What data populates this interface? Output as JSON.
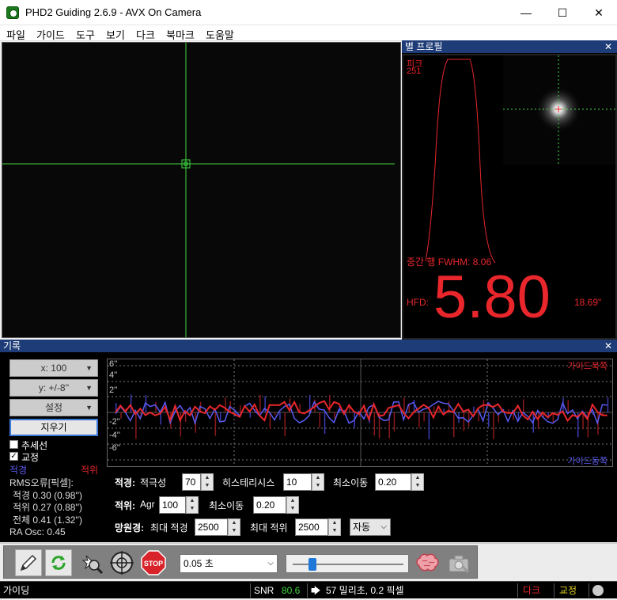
{
  "window": {
    "title": "PHD2 Guiding 2.6.9 - AVX On Camera",
    "minimize": "—",
    "maximize": "☐",
    "close": "✕"
  },
  "menu": {
    "file": "파일",
    "guide": "가이드",
    "tools": "도구",
    "view": "보기",
    "dark": "다크",
    "bookmarks": "북마크",
    "help": "도움말"
  },
  "star_profile": {
    "header": "별 프로필",
    "close": "✕",
    "peak_label": "피크",
    "peak_value": "251",
    "fwhm_text": "중간 행 FWHM: 8.06",
    "hfd_label": "HFD:",
    "hfd_value": "5.80",
    "hfd_arcsec": "18.69\""
  },
  "history": {
    "header": "기록",
    "close": "✕",
    "x_scale": "x: 100",
    "y_scale": "y: +/-8''",
    "settings": "설정",
    "clear": "지우기",
    "trendlines_label": "추세선",
    "trendlines_checked": false,
    "corrections_label": "교정",
    "corrections_checked": true,
    "ra_legend": "적경",
    "dec_legend": "적위",
    "rms_title": "RMS오류[픽셀]:",
    "rms_ra": "적경 0.30 (0.98'')",
    "rms_dec": "적위 0.27 (0.88'')",
    "rms_total": "전체 0.41 (1.32'')",
    "ra_osc": "RA Osc: 0.45",
    "y_ticks": [
      "6''",
      "4''",
      "2''",
      "-2''",
      "-4''",
      "-6''"
    ],
    "top_right_label": "가이드북쪽",
    "bottom_right_label": "가이드동쪽",
    "colors": {
      "ra": "#e8262b",
      "dec": "#5a5af0",
      "ra_bar": "#8b1a1a",
      "dec_bar": "#3c3cb4"
    }
  },
  "params": {
    "ra_label": "적경:",
    "ra_aggr_label": "적극성",
    "ra_aggr_value": "70",
    "hysteresis_label": "히스테리시스",
    "hysteresis_value": "10",
    "ra_minmove_label": "최소이동",
    "ra_minmove_value": "0.20",
    "dec_label": "적위:",
    "dec_agr_label": "Agr",
    "dec_agr_value": "100",
    "dec_minmove_label": "최소이동",
    "dec_minmove_value": "0.20",
    "mount_label": "망원경:",
    "max_ra_label": "최대 적경",
    "max_ra_value": "2500",
    "max_dec_label": "최대 적위",
    "max_dec_value": "2500",
    "dec_mode": "자동"
  },
  "toolbar": {
    "exposure": "0.05 초",
    "gamma_level": 0.18,
    "icons": [
      "pencil-icon",
      "loop-icon",
      "auto-select-star-icon",
      "guide-crosshair-icon",
      "stop-icon",
      "brain-icon",
      "camera-settings-icon"
    ],
    "stop_label": "STOP"
  },
  "status": {
    "state": "가이딩",
    "snr_label": "SNR",
    "snr_value": "80.6",
    "guide_text": "57 밀리초, 0.2 픽셀",
    "dark": "다크",
    "calibration": "교정"
  }
}
